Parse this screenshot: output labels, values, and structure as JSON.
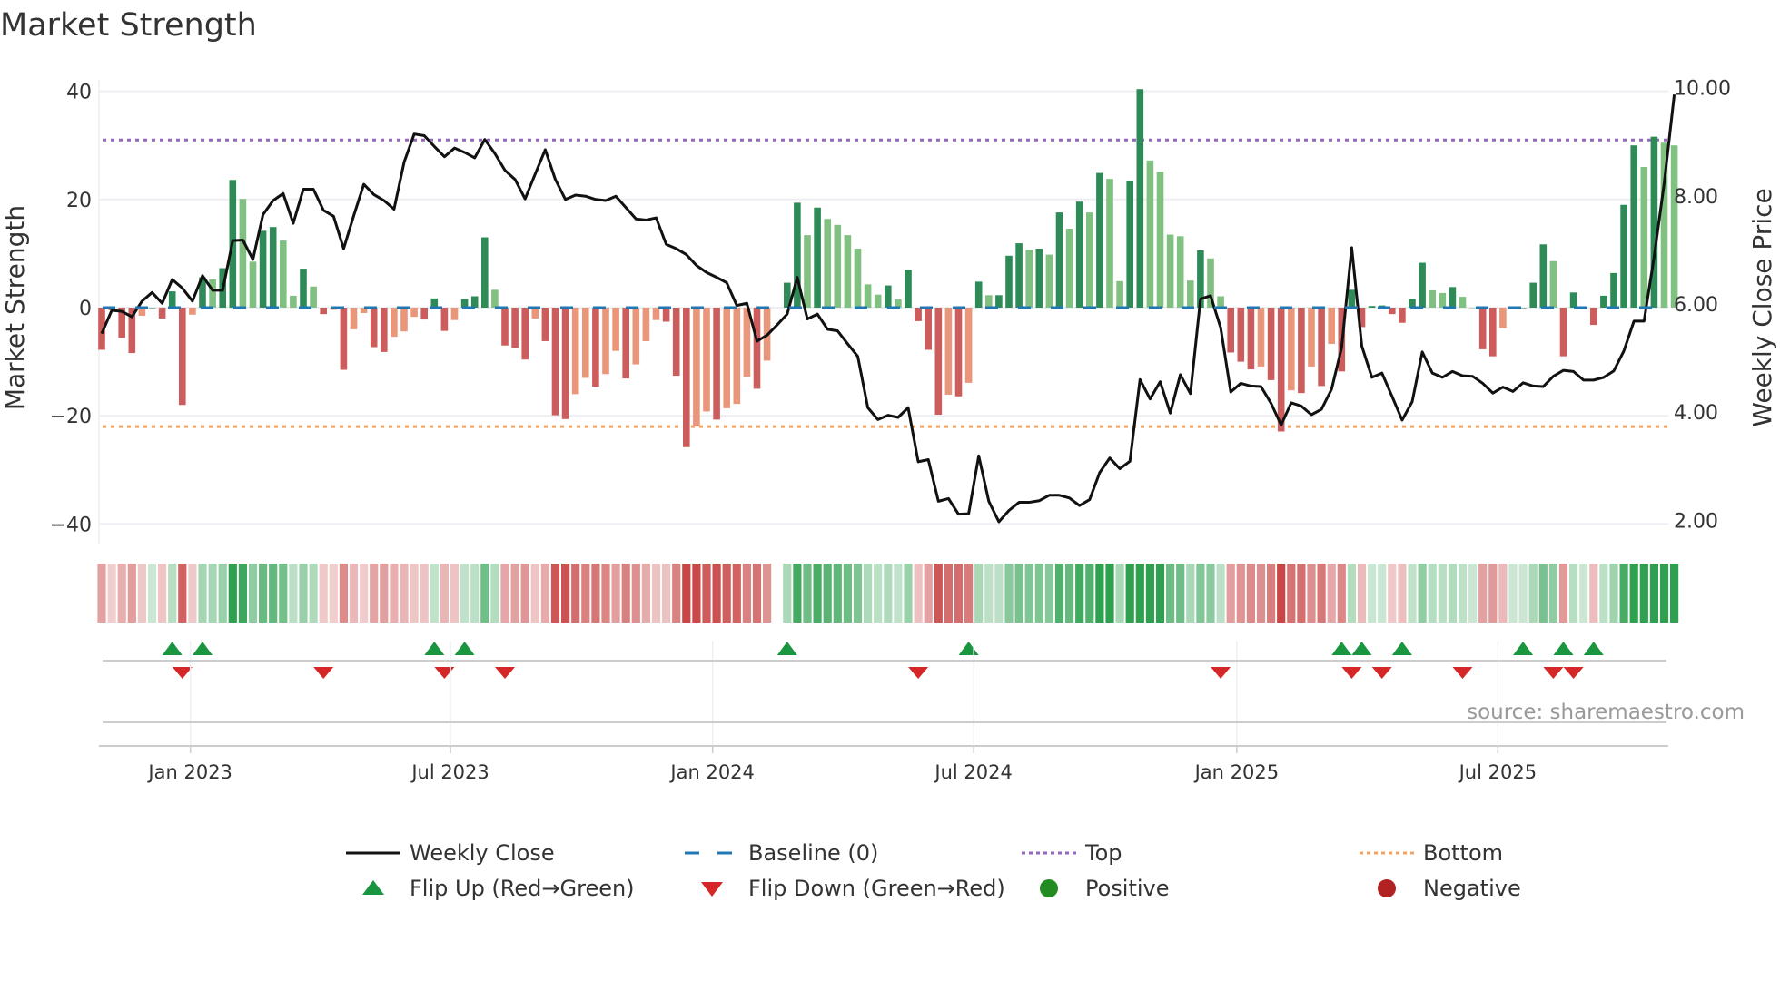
{
  "chart_data": {
    "type": "bar",
    "title": "Market Strength",
    "ylabel": "Market Strength",
    "y2label": "Weekly Close Price",
    "ylim": [
      -40,
      40
    ],
    "y2lim": [
      2,
      10
    ],
    "yticks": [
      "40",
      "20",
      "0",
      "−20",
      "−40"
    ],
    "ytick_values": [
      40,
      20,
      0,
      -20,
      -40
    ],
    "y2ticks": [
      "10.00",
      "8.00",
      "6.00",
      "4.00",
      "2.00"
    ],
    "y2tick_values": [
      10,
      8,
      6,
      4,
      2
    ],
    "x_unit": "week index",
    "xticks": [
      {
        "label": "Jan 2023",
        "week": 8.8
      },
      {
        "label": "Jul 2023",
        "week": 34.6
      },
      {
        "label": "Jan 2024",
        "week": 60.6
      },
      {
        "label": "Jul 2024",
        "week": 86.5
      },
      {
        "label": "Jan 2025",
        "week": 112.6
      },
      {
        "label": "Jul 2025",
        "week": 138.5
      }
    ],
    "top": 31,
    "bottom": -22,
    "baseline": 0,
    "strength": [
      -7.8,
      -0.5,
      -5.6,
      -8.4,
      -1.5,
      0,
      -2,
      3,
      -18,
      -1.3,
      5.6,
      5.2,
      7.3,
      23.6,
      20.1,
      8.5,
      14.2,
      14.9,
      12.4,
      2.2,
      7.2,
      3.9,
      -1.2,
      -0.4,
      -11.5,
      -4,
      -1,
      -7.3,
      -8.2,
      -5.4,
      -4.4,
      -1.7,
      -2.2,
      1.7,
      -4.3,
      -2.3,
      1.6,
      2.1,
      13,
      3.3,
      -7,
      -7.5,
      -9.6,
      -2,
      -6.2,
      -19.9,
      -20.6,
      -16,
      -13,
      -14.6,
      -12.3,
      -8,
      -13.1,
      -10.5,
      -6.2,
      -2.3,
      -2.6,
      -12.6,
      -25.8,
      -22,
      -19.2,
      -20.7,
      -18.6,
      -17.8,
      -12.8,
      -15,
      -9.8,
      null,
      4.6,
      19.4,
      13.4,
      18.5,
      16.4,
      15.3,
      13.4,
      10.9,
      4.3,
      2.4,
      4.1,
      1.5,
      7,
      -2.5,
      -7.8,
      -19.8,
      -16.1,
      -16.4,
      -13.9,
      4.8,
      2.3,
      2.3,
      9.6,
      11.9,
      10.7,
      10.9,
      9.8,
      17.6,
      14.6,
      19.6,
      17.6,
      24.9,
      23.8,
      4.9,
      23.4,
      40.4,
      27.2,
      25.1,
      13.5,
      13.2,
      5,
      10.6,
      9.1,
      2.1,
      -8.3,
      -10,
      -11.4,
      -10.9,
      -13.4,
      -22.9,
      -15.3,
      -15.8,
      -10.9,
      -14.5,
      -6.7,
      -11.8,
      3.3,
      -3.6,
      0.3,
      0.4,
      -1.2,
      -2.8,
      1.6,
      8.3,
      3.2,
      2.7,
      3.8,
      2,
      0,
      -7.7,
      -9,
      -3.8,
      0,
      0,
      4.6,
      11.7,
      8.6,
      -9,
      2.8,
      0,
      -3.2,
      2.2,
      6.4,
      19,
      30,
      26,
      31.6,
      30.5,
      30
    ],
    "price": [
      5.52,
      5.95,
      5.93,
      5.83,
      6.12,
      6.28,
      6.08,
      6.52,
      6.36,
      6.12,
      6.59,
      6.32,
      6.32,
      7.24,
      7.25,
      6.89,
      7.72,
      7.98,
      8.11,
      7.56,
      8.19,
      8.19,
      7.8,
      7.69,
      7.09,
      7.7,
      8.28,
      8.09,
      7.98,
      7.82,
      8.69,
      9.21,
      9.18,
      8.98,
      8.79,
      8.95,
      8.87,
      8.77,
      9.11,
      8.85,
      8.54,
      8.37,
      8.01,
      8.47,
      8.92,
      8.37,
      8.0,
      8.08,
      8.06,
      8.0,
      7.98,
      8.06,
      7.85,
      7.64,
      7.62,
      7.66,
      7.17,
      7.09,
      6.98,
      6.78,
      6.65,
      6.56,
      6.46,
      6.04,
      6.08,
      5.38,
      5.49,
      5.68,
      5.88,
      6.56,
      5.79,
      5.88,
      5.6,
      5.57,
      5.33,
      5.1,
      4.15,
      3.93,
      4.01,
      3.97,
      4.15,
      3.15,
      3.19,
      2.42,
      2.47,
      2.18,
      2.19,
      3.26,
      2.42,
      2.04,
      2.25,
      2.4,
      2.4,
      2.43,
      2.53,
      2.53,
      2.48,
      2.34,
      2.45,
      2.95,
      3.22,
      3.02,
      3.16,
      4.67,
      4.31,
      4.63,
      4.05,
      4.76,
      4.41,
      6.16,
      6.22,
      5.63,
      4.44,
      4.6,
      4.55,
      4.54,
      4.23,
      3.83,
      4.24,
      4.18,
      4.02,
      4.12,
      4.49,
      5.26,
      7.11,
      5.29,
      4.71,
      4.79,
      4.36,
      3.92,
      4.26,
      5.18,
      4.79,
      4.71,
      4.82,
      4.74,
      4.73,
      4.6,
      4.42,
      4.53,
      4.45,
      4.61,
      4.55,
      4.54,
      4.73,
      4.84,
      4.82,
      4.66,
      4.66,
      4.71,
      4.83,
      5.2,
      5.75,
      5.75,
      6.94,
      8.3,
      9.94
    ],
    "flip_up_weeks": [
      7,
      10,
      33,
      36,
      68,
      86,
      123,
      125,
      129,
      141,
      145,
      148
    ],
    "flip_down_weeks": [
      8,
      22,
      34,
      40,
      81,
      111,
      124,
      127,
      135,
      144,
      146
    ],
    "colors": {
      "pos_strong": "#2e8b57",
      "pos_weak": "#80c080",
      "neg_strong": "#cd5c5c",
      "neg_weak": "#e9967a",
      "line": "#111111",
      "baseline": "#1f77b4",
      "top": "#9467bd",
      "bottom": "#f4a460",
      "flip_up": "#1a9641",
      "flip_down": "#d62728",
      "positive": "#228b22",
      "negative": "#b22222"
    },
    "legend": [
      {
        "label": "Weekly Close",
        "kind": "line"
      },
      {
        "label": "Baseline (0)",
        "kind": "dash"
      },
      {
        "label": "Top",
        "kind": "dot-top"
      },
      {
        "label": "Bottom",
        "kind": "dot-bottom"
      },
      {
        "label": "Flip Up (Red→Green)",
        "kind": "tri-up"
      },
      {
        "label": "Flip Down (Green→Red)",
        "kind": "tri-down"
      },
      {
        "label": "Positive",
        "kind": "circle-pos"
      },
      {
        "label": "Negative",
        "kind": "circle-neg"
      }
    ],
    "source": "source: sharemaestro.com"
  }
}
